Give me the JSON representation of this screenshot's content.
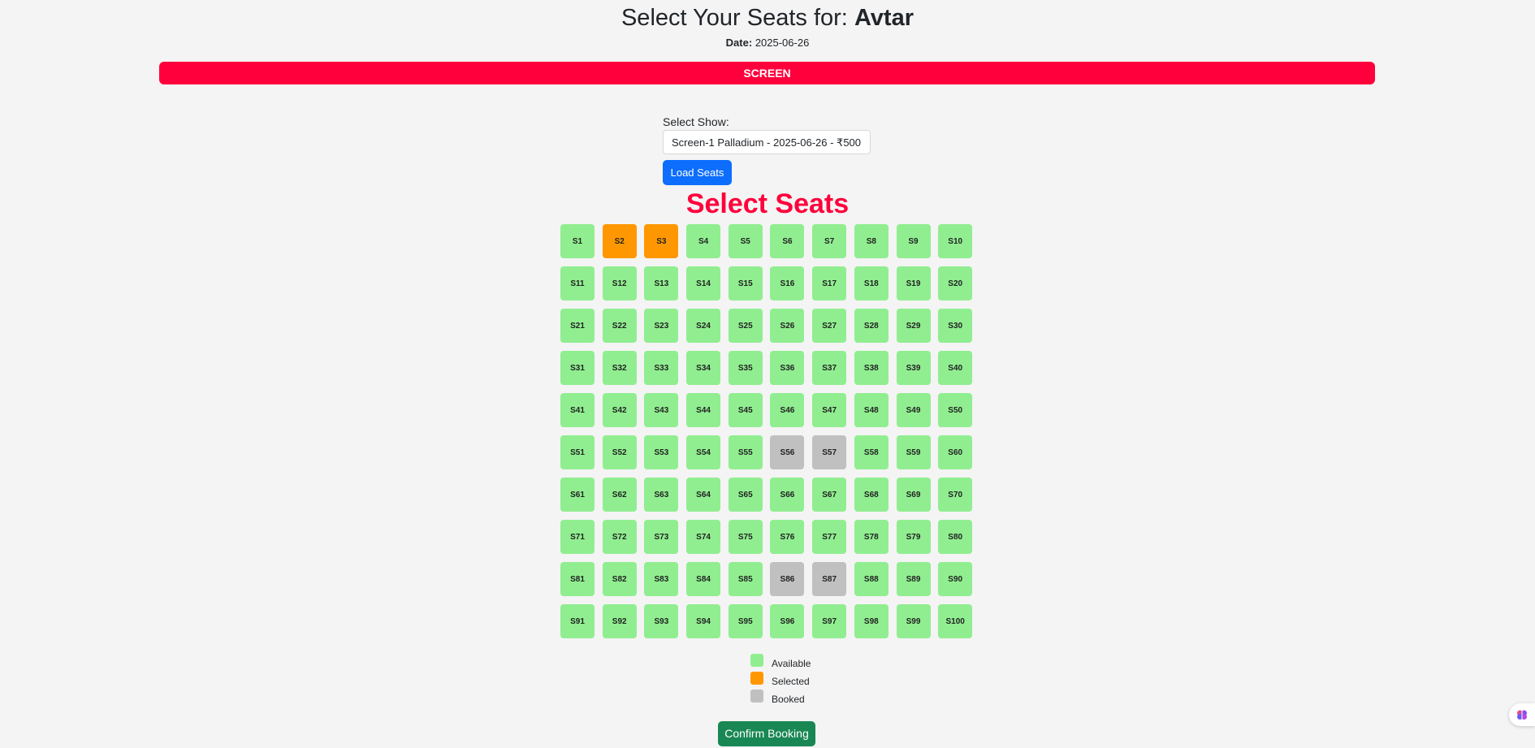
{
  "header": {
    "title_prefix": "Select Your Seats for:",
    "movie": "Avtar",
    "date_label": "Date:",
    "date_value": "2025-06-26"
  },
  "screen_label": "SCREEN",
  "show_picker": {
    "label": "Select Show:",
    "selected": "Screen-1 Palladium - 2025-06-26 - ₹500",
    "load_button": "Load Seats"
  },
  "seats_heading": "Select Seats",
  "seat_prefix": "S",
  "seat_count": 100,
  "selected_seats": [
    2,
    3
  ],
  "booked_seats": [
    56,
    57,
    86,
    87
  ],
  "legend": [
    {
      "label": "Available",
      "color": "#90ee90"
    },
    {
      "label": "Selected",
      "color": "#ff9800"
    },
    {
      "label": "Booked",
      "color": "#c0c0c0"
    }
  ],
  "confirm_button": "Confirm Booking",
  "colors": {
    "accent": "#ff003c",
    "primary_button": "#0d6efd",
    "confirm_button": "#198754"
  },
  "float_icon": "brain-icon"
}
